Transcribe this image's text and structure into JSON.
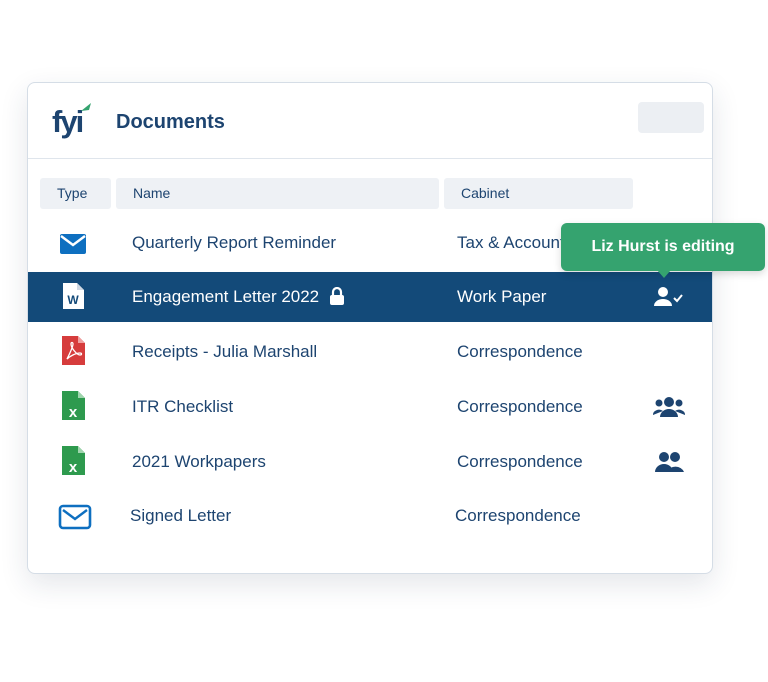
{
  "header": {
    "logo_text": "fyi",
    "title": "Documents"
  },
  "columns": {
    "type": "Type",
    "name": "Name",
    "cabinet": "Cabinet"
  },
  "rows": [
    {
      "icon": "email-icon",
      "name": "Quarterly Report Reminder",
      "cabinet": "Tax & Accounting",
      "locked": false,
      "users": "none"
    },
    {
      "icon": "word-doc-icon",
      "name": "Engagement Letter 2022",
      "cabinet": "Work Paper",
      "locked": true,
      "users": "user-editing-icon",
      "selected": true
    },
    {
      "icon": "pdf-icon",
      "name": "Receipts - Julia Marshall",
      "cabinet": "Correspondence",
      "locked": false,
      "users": "none"
    },
    {
      "icon": "excel-icon",
      "name": "ITR Checklist",
      "cabinet": "Correspondence",
      "locked": false,
      "users": "group-three-icon"
    },
    {
      "icon": "excel-icon",
      "name": "2021 Workpapers",
      "cabinet": "Correspondence",
      "locked": false,
      "users": "group-two-icon"
    },
    {
      "icon": "email-outline-icon",
      "name": "Signed Letter",
      "cabinet": "Correspondence",
      "locked": false,
      "users": "none"
    }
  ],
  "tooltip": {
    "text": "Liz Hurst is editing"
  },
  "colors": {
    "brand_navy": "#1d4470",
    "selected_row": "#134a79",
    "tooltip_green": "#35a36f",
    "word_blue": "#1b5fae",
    "pdf_red": "#d63c3c",
    "excel_green": "#2e9a4e",
    "email_blue": "#0e6fc0"
  }
}
